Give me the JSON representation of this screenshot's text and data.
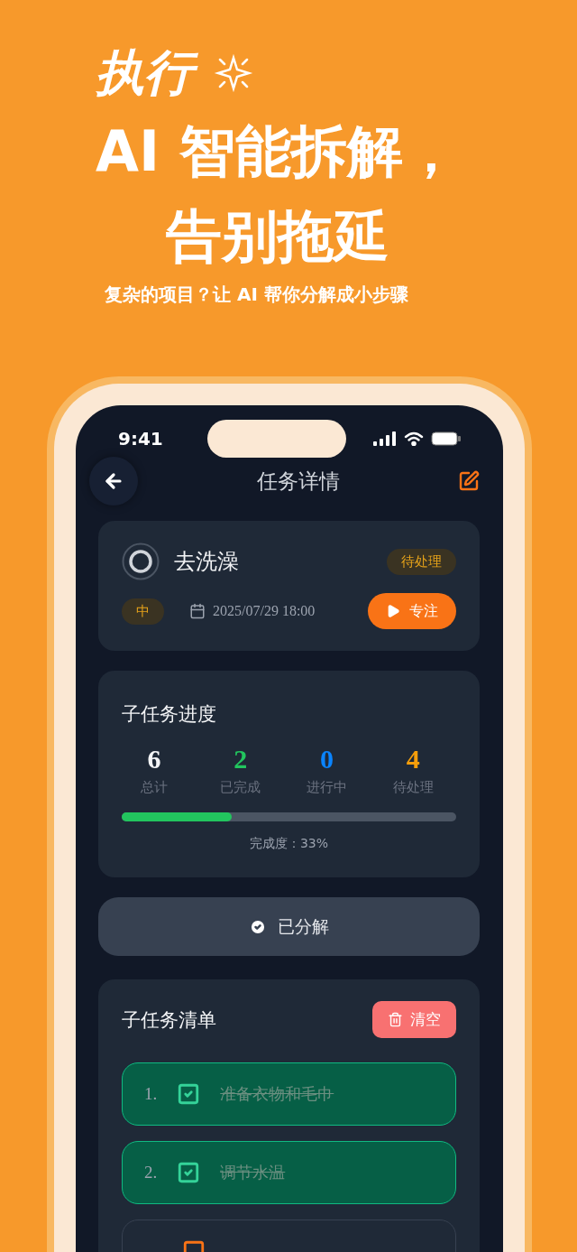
{
  "headline": {
    "line_1": "执行",
    "line_2": "AI 智能拆解，",
    "line_3": "告别拖延",
    "subtitle": "复杂的项目？让 AI 帮你分解成小步骤"
  },
  "status_bar": {
    "time": "9:41"
  },
  "nav": {
    "title": "任务详情"
  },
  "task": {
    "title": "去洗澡",
    "status": "待处理",
    "priority": "中",
    "due": "2025/07/29 18:00",
    "focus_button": "专注"
  },
  "progress": {
    "title": "子任务进度",
    "stats": [
      {
        "value": "6",
        "label": "总计",
        "color": "#f3f4f6"
      },
      {
        "value": "2",
        "label": "已完成",
        "color": "#22c55e"
      },
      {
        "value": "0",
        "label": "进行中",
        "color": "#0a84ff"
      },
      {
        "value": "4",
        "label": "待处理",
        "color": "#f59e0b"
      }
    ],
    "level": 0.33,
    "reading": "完成度：33%"
  },
  "decompose_button": "已分解",
  "subtasks": {
    "title": "子任务清单",
    "clear_button": "清空",
    "items": [
      {
        "number": "1.",
        "text": "准备衣物和毛巾",
        "checked": true
      },
      {
        "number": "2.",
        "text": "调节水温",
        "checked": true
      },
      {
        "checked": false
      }
    ]
  }
}
